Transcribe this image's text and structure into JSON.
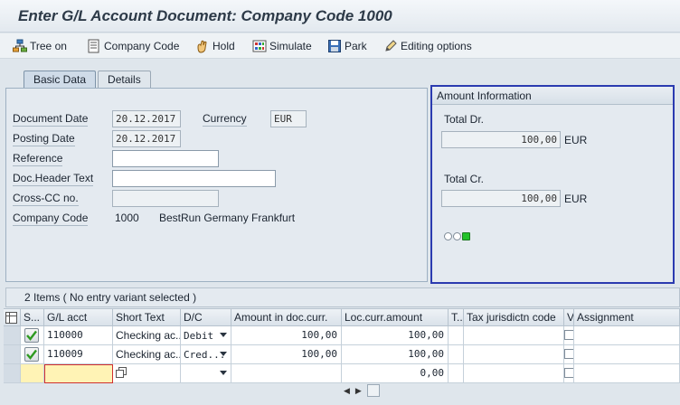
{
  "window": {
    "title": "Enter G/L Account Document: Company Code 1000"
  },
  "toolbar": {
    "tree_on": "Tree on",
    "company_code": "Company Code",
    "hold": "Hold",
    "simulate": "Simulate",
    "park": "Park",
    "editing_options": "Editing options"
  },
  "tabs": {
    "basic_data": "Basic Data",
    "details": "Details"
  },
  "basic_data": {
    "document_date_label": "Document Date",
    "document_date": "20.12.2017",
    "currency_label": "Currency",
    "currency": "EUR",
    "posting_date_label": "Posting Date",
    "posting_date": "20.12.2017",
    "reference_label": "Reference",
    "reference": "",
    "doc_header_text_label": "Doc.Header Text",
    "doc_header_text": "",
    "cross_cc_label": "Cross-CC no.",
    "cross_cc": "",
    "company_code_label": "Company Code",
    "company_code": "1000",
    "company_name": "BestRun Germany Frankfurt"
  },
  "amount_info": {
    "header": "Amount Information",
    "total_dr_label": "Total Dr.",
    "total_dr": "100,00",
    "total_dr_currency": "EUR",
    "total_cr_label": "Total Cr.",
    "total_cr": "100,00",
    "total_cr_currency": "EUR",
    "status_colors": [
      "#ffffff",
      "#ffffff",
      "#22c22a"
    ]
  },
  "items": {
    "title": "2 Items ( No entry variant selected )",
    "columns": {
      "status": "S...",
      "gl_acct": "G/L acct",
      "short_text": "Short Text",
      "dc": "D/C",
      "amount_doc": "Amount in doc.curr.",
      "amount_loc": "Loc.curr.amount",
      "t": "T..",
      "tax_juris": "Tax jurisdictn code",
      "v": "V",
      "assignment": "Assignment"
    },
    "rows": [
      {
        "gl_acct": "110000",
        "short_text": "Checking ac...",
        "dc": "Debit",
        "amount_doc": "100,00",
        "amount_loc": "100,00"
      },
      {
        "gl_acct": "110009",
        "short_text": "Checking ac...",
        "dc": "Cred...",
        "amount_doc": "100,00",
        "amount_loc": "100,00"
      },
      {
        "gl_acct": "",
        "short_text": "",
        "dc": "",
        "amount_doc": "",
        "amount_loc": "0,00"
      }
    ]
  }
}
